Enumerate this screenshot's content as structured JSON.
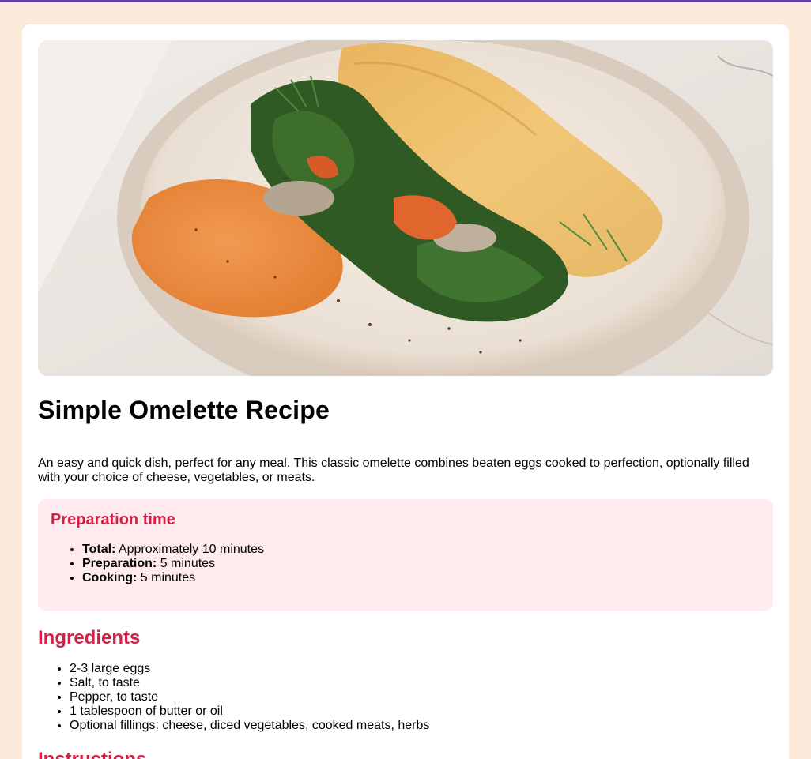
{
  "recipe": {
    "hero_image_alt": "Omelette with spinach, herbs and orange spread on a ceramic plate",
    "title": "Simple Omelette Recipe",
    "description": "An easy and quick dish, perfect for any meal. This classic omelette combines beaten eggs cooked to perfection, optionally filled with your choice of cheese, vegetables, or meats."
  },
  "preparation": {
    "heading": "Preparation time",
    "items": [
      {
        "label": "Total:",
        "value": "Approximately 10 minutes"
      },
      {
        "label": "Preparation:",
        "value": "5 minutes"
      },
      {
        "label": "Cooking:",
        "value": "5 minutes"
      }
    ]
  },
  "ingredients": {
    "heading": "Ingredients",
    "items": [
      "2-3 large eggs",
      "Salt, to taste",
      "Pepper, to taste",
      "1 tablespoon of butter or oil",
      "Optional fillings: cheese, diced vegetables, cooked meats, herbs"
    ]
  },
  "instructions": {
    "heading": "Instructions"
  },
  "colors": {
    "page_background": "#fbead9",
    "top_border": "#6a3fa0",
    "accent": "#d41f47",
    "prep_background": "#ffebee",
    "card_background": "#ffffff"
  }
}
